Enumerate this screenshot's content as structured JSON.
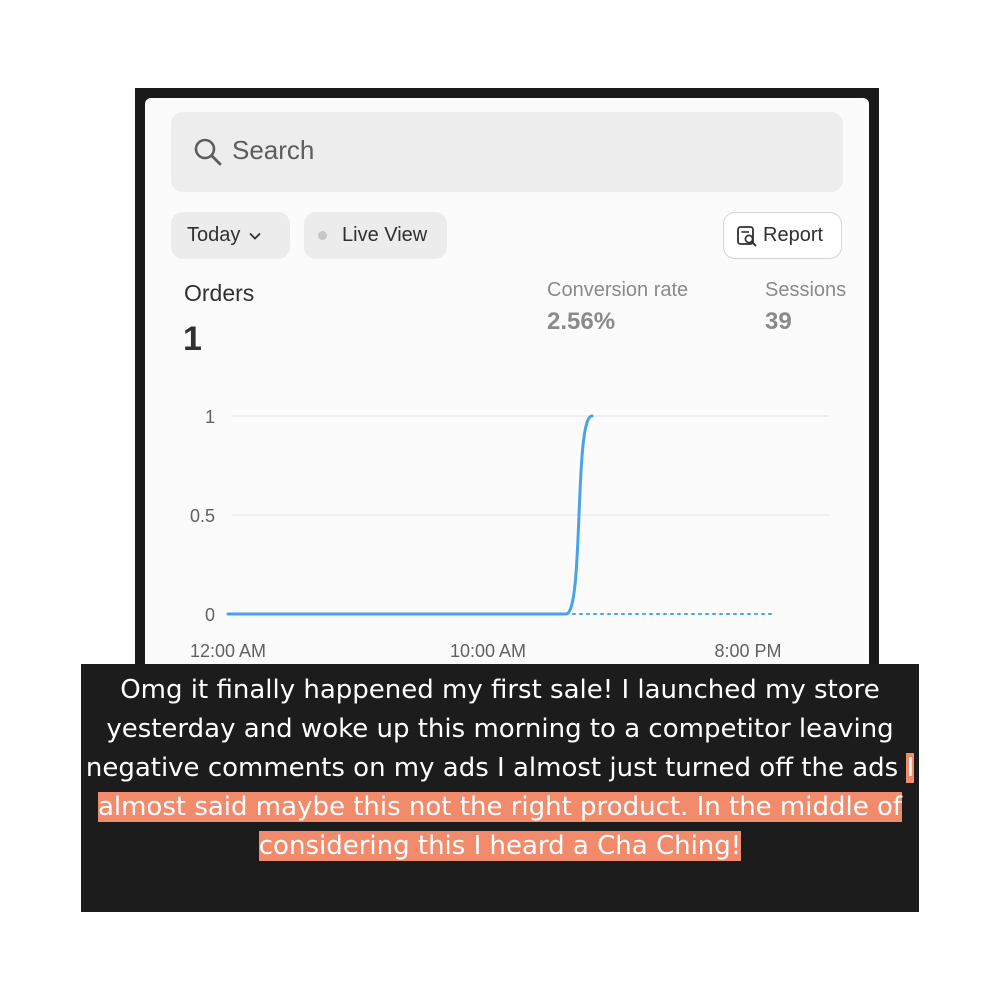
{
  "search": {
    "label": "Search"
  },
  "filters": {
    "date_label": "Today",
    "live_label": "Live View",
    "report_label": "Report"
  },
  "metrics": {
    "orders_label": "Orders",
    "orders_value": "1",
    "conversion_label": "Conversion rate",
    "conversion_value": "2.56%",
    "sessions_label": "Sessions",
    "sessions_value": "39"
  },
  "chart_data": {
    "type": "line",
    "title": "",
    "xlabel": "",
    "ylabel": "",
    "x_tick_labels": [
      "12:00 AM",
      "10:00 AM",
      "8:00 PM"
    ],
    "y_tick_labels": [
      "0",
      "0.5",
      "1"
    ],
    "ylim": [
      0,
      1
    ],
    "grid": true,
    "series": [
      {
        "x": [
          "12:00 AM",
          "1:00 AM",
          "2:00 AM",
          "3:00 AM",
          "4:00 AM",
          "5:00 AM",
          "6:00 AM",
          "7:00 AM",
          "8:00 AM",
          "9:00 AM",
          "10:00 AM",
          "11:00 AM",
          "12:00 PM",
          "1:00 PM",
          "2:00 PM"
        ],
        "y": [
          0,
          0,
          0,
          0,
          0,
          0,
          0,
          0,
          0,
          0,
          0,
          0,
          0,
          0,
          1
        ],
        "style": "solid",
        "color": "#4aa3e6"
      },
      {
        "x": [
          "1:00 PM",
          "2:00 PM",
          "3:00 PM",
          "4:00 PM",
          "5:00 PM",
          "6:00 PM",
          "7:00 PM",
          "8:00 PM",
          "9:00 PM"
        ],
        "y": [
          0,
          0,
          0,
          0,
          0,
          0,
          0,
          0,
          0
        ],
        "style": "dotted",
        "color": "#4aa3e6"
      }
    ]
  },
  "caption": {
    "plain": "Omg it finally happened my first sale! I launched my store yesterday and woke up this morning to a competitor leaving negative comments on my ads I almost just turned off the ads",
    "highlighted": "I almost said maybe this not the right product. In the middle of considering this I heard a Cha Ching!",
    "highlight_color": "#f28a6c"
  }
}
